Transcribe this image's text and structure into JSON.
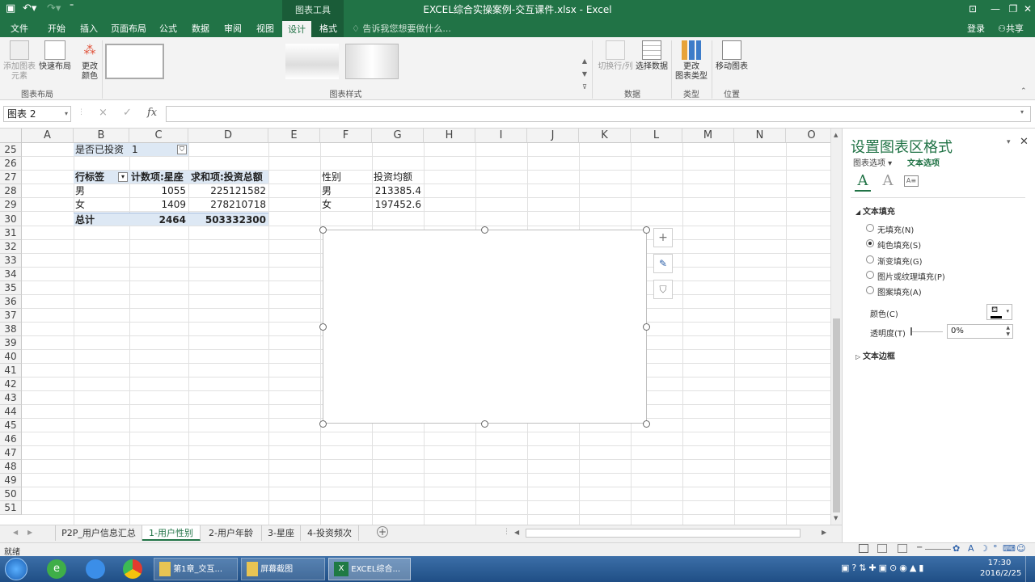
{
  "titlebar": {
    "title": "EXCEL综合实操案例-交互课件.xlsx - Excel",
    "contextual_tab_group": "图表工具",
    "save_icon": "save-icon",
    "undo_icon": "undo-icon",
    "redo_icon": "redo-icon"
  },
  "tabs": {
    "items": [
      "文件",
      "开始",
      "插入",
      "页面布局",
      "公式",
      "数据",
      "审阅",
      "视图",
      "设计",
      "格式"
    ],
    "active": "设计",
    "tell_me": "告诉我您想要做什么...",
    "login": "登录",
    "share": "共享"
  },
  "ribbon": {
    "add_element": "添加图表",
    "add_element2": "元素",
    "quick_layout": "快速布局",
    "change_color": "更改",
    "change_color2": "颜色",
    "group_layout": "图表布局",
    "group_styles": "图表样式",
    "switch_rowcol": "切换行/列",
    "select_data": "选择数据",
    "group_data": "数据",
    "change_type": "更改",
    "change_type2": "图表类型",
    "group_type": "类型",
    "move_chart": "移动图表",
    "group_location": "位置"
  },
  "formula_bar": {
    "name_box": "图表 2",
    "cancel_icon": "×",
    "enter_icon": "✓",
    "fx_label": "fx",
    "value": ""
  },
  "grid": {
    "columns": [
      "A",
      "B",
      "C",
      "D",
      "E",
      "F",
      "G",
      "H",
      "I",
      "J",
      "K",
      "L",
      "M",
      "N",
      "O"
    ],
    "rows": [
      "25",
      "26",
      "27",
      "28",
      "29",
      "30",
      "31",
      "32",
      "33",
      "34",
      "35",
      "36",
      "37",
      "38",
      "39",
      "40",
      "41",
      "42",
      "43",
      "44",
      "45",
      "46",
      "47",
      "48",
      "49",
      "50",
      "51"
    ],
    "filter": {
      "label": "是否已投资",
      "value": "1"
    },
    "pivot": {
      "headers": [
        "行标签",
        "计数项:星座",
        "求和项:投资总额"
      ],
      "rows": [
        [
          "男",
          "1055",
          "225121582"
        ],
        [
          "女",
          "1409",
          "278210718"
        ]
      ],
      "total": [
        "总计",
        "2464",
        "503332300"
      ]
    },
    "side_table": {
      "headers": [
        "性别",
        "投资均额"
      ],
      "rows": [
        [
          "男",
          "213385.4"
        ],
        [
          "女",
          "197452.6"
        ]
      ]
    }
  },
  "chart_side_buttons": {
    "plus": "+",
    "brush": "✎",
    "filter": "⛉"
  },
  "pane": {
    "title": "设置图表区格式",
    "subtab1": "图表选项",
    "subtab2": "文本选项",
    "section_fill": "文本填充",
    "options": [
      "无填充(N)",
      "纯色填充(S)",
      "渐变填充(G)",
      "图片或纹理填充(P)",
      "图案填充(A)"
    ],
    "selected_option": 1,
    "color_label": "颜色(C)",
    "transparency_label": "透明度(T)",
    "transparency_value": "0%",
    "section_border": "文本边框"
  },
  "sheets": {
    "tabs": [
      "P2P_用户信息汇总",
      "1-用户性别",
      "2-用户年龄",
      "3-星座",
      "4-投资频次"
    ],
    "active": "1-用户性别"
  },
  "status": {
    "ready": "就绪"
  },
  "taskbar": {
    "items": [
      "第1章_交互...",
      "屏幕截图",
      "EXCEL综合..."
    ],
    "time": "17:30",
    "date": "2016/2/25"
  },
  "colors": {
    "excel_green": "#217346",
    "header_highlight": "#dde8f4"
  }
}
